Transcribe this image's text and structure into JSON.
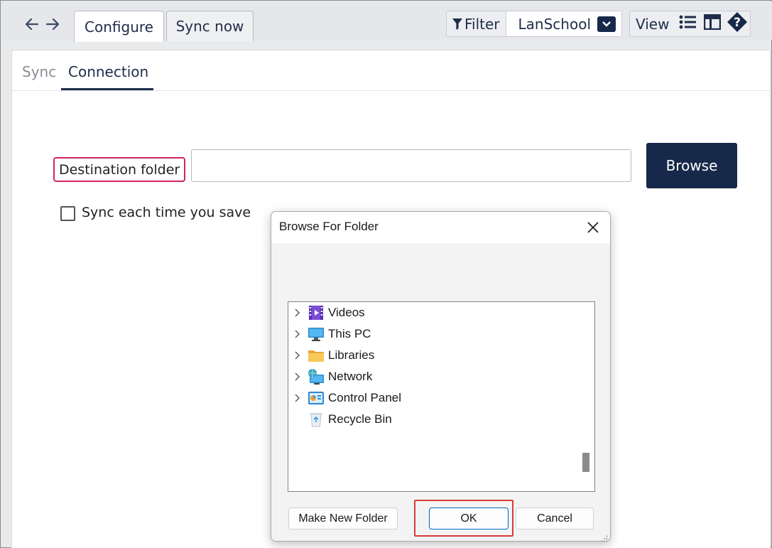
{
  "topbar": {
    "tabs": [
      {
        "label": "Configure",
        "active": true
      },
      {
        "label": "Sync now",
        "active": false
      }
    ],
    "filter_label": "Filter",
    "filter_value": "LanSchool",
    "view_label": "View"
  },
  "subtabs": [
    {
      "label": "Sync",
      "active": false
    },
    {
      "label": "Connection",
      "active": true
    }
  ],
  "form": {
    "destination_label": "Destination folder",
    "destination_value": "",
    "browse_label": "Browse",
    "sync_checkbox_label": "Sync each time you save",
    "sync_checked": false
  },
  "dialog": {
    "title": "Browse For Folder",
    "tree_items": [
      {
        "label": "Videos",
        "icon": "videos-folder-icon",
        "expandable": true
      },
      {
        "label": "This PC",
        "icon": "this-pc-icon",
        "expandable": true
      },
      {
        "label": "Libraries",
        "icon": "libraries-folder-icon",
        "expandable": true
      },
      {
        "label": "Network",
        "icon": "network-icon",
        "expandable": true
      },
      {
        "label": "Control Panel",
        "icon": "control-panel-icon",
        "expandable": true
      },
      {
        "label": "Recycle Bin",
        "icon": "recycle-bin-icon",
        "expandable": false
      }
    ],
    "make_new_folder_label": "Make New Folder",
    "ok_label": "OK",
    "cancel_label": "Cancel"
  },
  "colors": {
    "accent_dark": "#17294a",
    "highlight_pink": "#d1245f",
    "highlight_red": "#d83b3b"
  }
}
